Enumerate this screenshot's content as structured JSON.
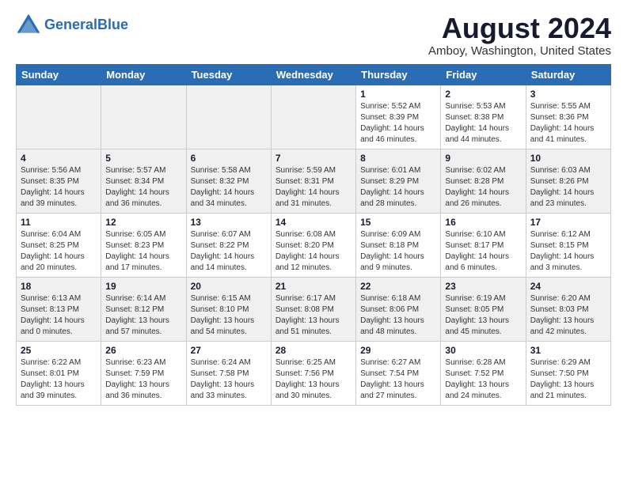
{
  "header": {
    "logo_line1": "General",
    "logo_line2": "Blue",
    "month_year": "August 2024",
    "location": "Amboy, Washington, United States"
  },
  "days_of_week": [
    "Sunday",
    "Monday",
    "Tuesday",
    "Wednesday",
    "Thursday",
    "Friday",
    "Saturday"
  ],
  "weeks": [
    [
      {
        "day": "",
        "info": ""
      },
      {
        "day": "",
        "info": ""
      },
      {
        "day": "",
        "info": ""
      },
      {
        "day": "",
        "info": ""
      },
      {
        "day": "1",
        "info": "Sunrise: 5:52 AM\nSunset: 8:39 PM\nDaylight: 14 hours\nand 46 minutes."
      },
      {
        "day": "2",
        "info": "Sunrise: 5:53 AM\nSunset: 8:38 PM\nDaylight: 14 hours\nand 44 minutes."
      },
      {
        "day": "3",
        "info": "Sunrise: 5:55 AM\nSunset: 8:36 PM\nDaylight: 14 hours\nand 41 minutes."
      }
    ],
    [
      {
        "day": "4",
        "info": "Sunrise: 5:56 AM\nSunset: 8:35 PM\nDaylight: 14 hours\nand 39 minutes."
      },
      {
        "day": "5",
        "info": "Sunrise: 5:57 AM\nSunset: 8:34 PM\nDaylight: 14 hours\nand 36 minutes."
      },
      {
        "day": "6",
        "info": "Sunrise: 5:58 AM\nSunset: 8:32 PM\nDaylight: 14 hours\nand 34 minutes."
      },
      {
        "day": "7",
        "info": "Sunrise: 5:59 AM\nSunset: 8:31 PM\nDaylight: 14 hours\nand 31 minutes."
      },
      {
        "day": "8",
        "info": "Sunrise: 6:01 AM\nSunset: 8:29 PM\nDaylight: 14 hours\nand 28 minutes."
      },
      {
        "day": "9",
        "info": "Sunrise: 6:02 AM\nSunset: 8:28 PM\nDaylight: 14 hours\nand 26 minutes."
      },
      {
        "day": "10",
        "info": "Sunrise: 6:03 AM\nSunset: 8:26 PM\nDaylight: 14 hours\nand 23 minutes."
      }
    ],
    [
      {
        "day": "11",
        "info": "Sunrise: 6:04 AM\nSunset: 8:25 PM\nDaylight: 14 hours\nand 20 minutes."
      },
      {
        "day": "12",
        "info": "Sunrise: 6:05 AM\nSunset: 8:23 PM\nDaylight: 14 hours\nand 17 minutes."
      },
      {
        "day": "13",
        "info": "Sunrise: 6:07 AM\nSunset: 8:22 PM\nDaylight: 14 hours\nand 14 minutes."
      },
      {
        "day": "14",
        "info": "Sunrise: 6:08 AM\nSunset: 8:20 PM\nDaylight: 14 hours\nand 12 minutes."
      },
      {
        "day": "15",
        "info": "Sunrise: 6:09 AM\nSunset: 8:18 PM\nDaylight: 14 hours\nand 9 minutes."
      },
      {
        "day": "16",
        "info": "Sunrise: 6:10 AM\nSunset: 8:17 PM\nDaylight: 14 hours\nand 6 minutes."
      },
      {
        "day": "17",
        "info": "Sunrise: 6:12 AM\nSunset: 8:15 PM\nDaylight: 14 hours\nand 3 minutes."
      }
    ],
    [
      {
        "day": "18",
        "info": "Sunrise: 6:13 AM\nSunset: 8:13 PM\nDaylight: 14 hours\nand 0 minutes."
      },
      {
        "day": "19",
        "info": "Sunrise: 6:14 AM\nSunset: 8:12 PM\nDaylight: 13 hours\nand 57 minutes."
      },
      {
        "day": "20",
        "info": "Sunrise: 6:15 AM\nSunset: 8:10 PM\nDaylight: 13 hours\nand 54 minutes."
      },
      {
        "day": "21",
        "info": "Sunrise: 6:17 AM\nSunset: 8:08 PM\nDaylight: 13 hours\nand 51 minutes."
      },
      {
        "day": "22",
        "info": "Sunrise: 6:18 AM\nSunset: 8:06 PM\nDaylight: 13 hours\nand 48 minutes."
      },
      {
        "day": "23",
        "info": "Sunrise: 6:19 AM\nSunset: 8:05 PM\nDaylight: 13 hours\nand 45 minutes."
      },
      {
        "day": "24",
        "info": "Sunrise: 6:20 AM\nSunset: 8:03 PM\nDaylight: 13 hours\nand 42 minutes."
      }
    ],
    [
      {
        "day": "25",
        "info": "Sunrise: 6:22 AM\nSunset: 8:01 PM\nDaylight: 13 hours\nand 39 minutes."
      },
      {
        "day": "26",
        "info": "Sunrise: 6:23 AM\nSunset: 7:59 PM\nDaylight: 13 hours\nand 36 minutes."
      },
      {
        "day": "27",
        "info": "Sunrise: 6:24 AM\nSunset: 7:58 PM\nDaylight: 13 hours\nand 33 minutes."
      },
      {
        "day": "28",
        "info": "Sunrise: 6:25 AM\nSunset: 7:56 PM\nDaylight: 13 hours\nand 30 minutes."
      },
      {
        "day": "29",
        "info": "Sunrise: 6:27 AM\nSunset: 7:54 PM\nDaylight: 13 hours\nand 27 minutes."
      },
      {
        "day": "30",
        "info": "Sunrise: 6:28 AM\nSunset: 7:52 PM\nDaylight: 13 hours\nand 24 minutes."
      },
      {
        "day": "31",
        "info": "Sunrise: 6:29 AM\nSunset: 7:50 PM\nDaylight: 13 hours\nand 21 minutes."
      }
    ]
  ]
}
